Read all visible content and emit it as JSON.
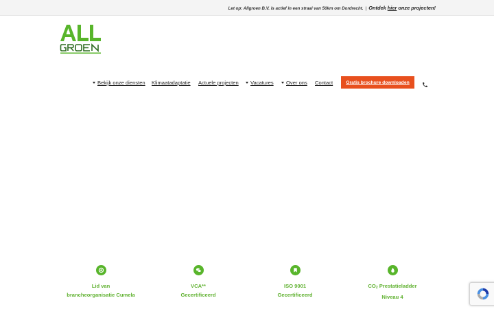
{
  "topbar": {
    "notice": "Let op: Allgroen B.V. is actief in een straal van 50km om Dordrecht.",
    "separator": "|",
    "cta_prefix": "Ontdek ",
    "cta_link": "hier",
    "cta_suffix": " onze projecten!"
  },
  "logo": {
    "line1": "ALL",
    "line2": "GROEN"
  },
  "nav": {
    "items": [
      {
        "label": "Bekijk onze diensten",
        "dropdown": true
      },
      {
        "label": "Klimaatadaptatie",
        "dropdown": false
      },
      {
        "label": "Actuele projecten",
        "dropdown": false
      },
      {
        "label": "Vacatures",
        "dropdown": true
      },
      {
        "label": "Over ons",
        "dropdown": true
      },
      {
        "label": "Contact",
        "dropdown": false
      }
    ],
    "cta_label": "Gratis brochure downloaden",
    "phone_icon": "phone-icon"
  },
  "features": [
    {
      "icon": "circle-dot-icon",
      "line1": "Lid van",
      "line2": "brancheorganisatie Cumela"
    },
    {
      "icon": "chat-bubbles-icon",
      "line1": "VCA**",
      "line2": "Gecertificeerd"
    },
    {
      "icon": "bookmark-icon",
      "line1": "ISO 9001",
      "line2": "Gecertificeerd"
    },
    {
      "icon": "drop-icon",
      "line1_main": "CO",
      "line1_sub": "2",
      "line1_rest": " Prestatieladder",
      "line2": "Niveau 4"
    }
  ],
  "colors": {
    "brand_green": "#58b52b",
    "cta_orange": "#e8501e",
    "text_dark": "#222222",
    "topbar_bg": "#f4f4f4"
  }
}
